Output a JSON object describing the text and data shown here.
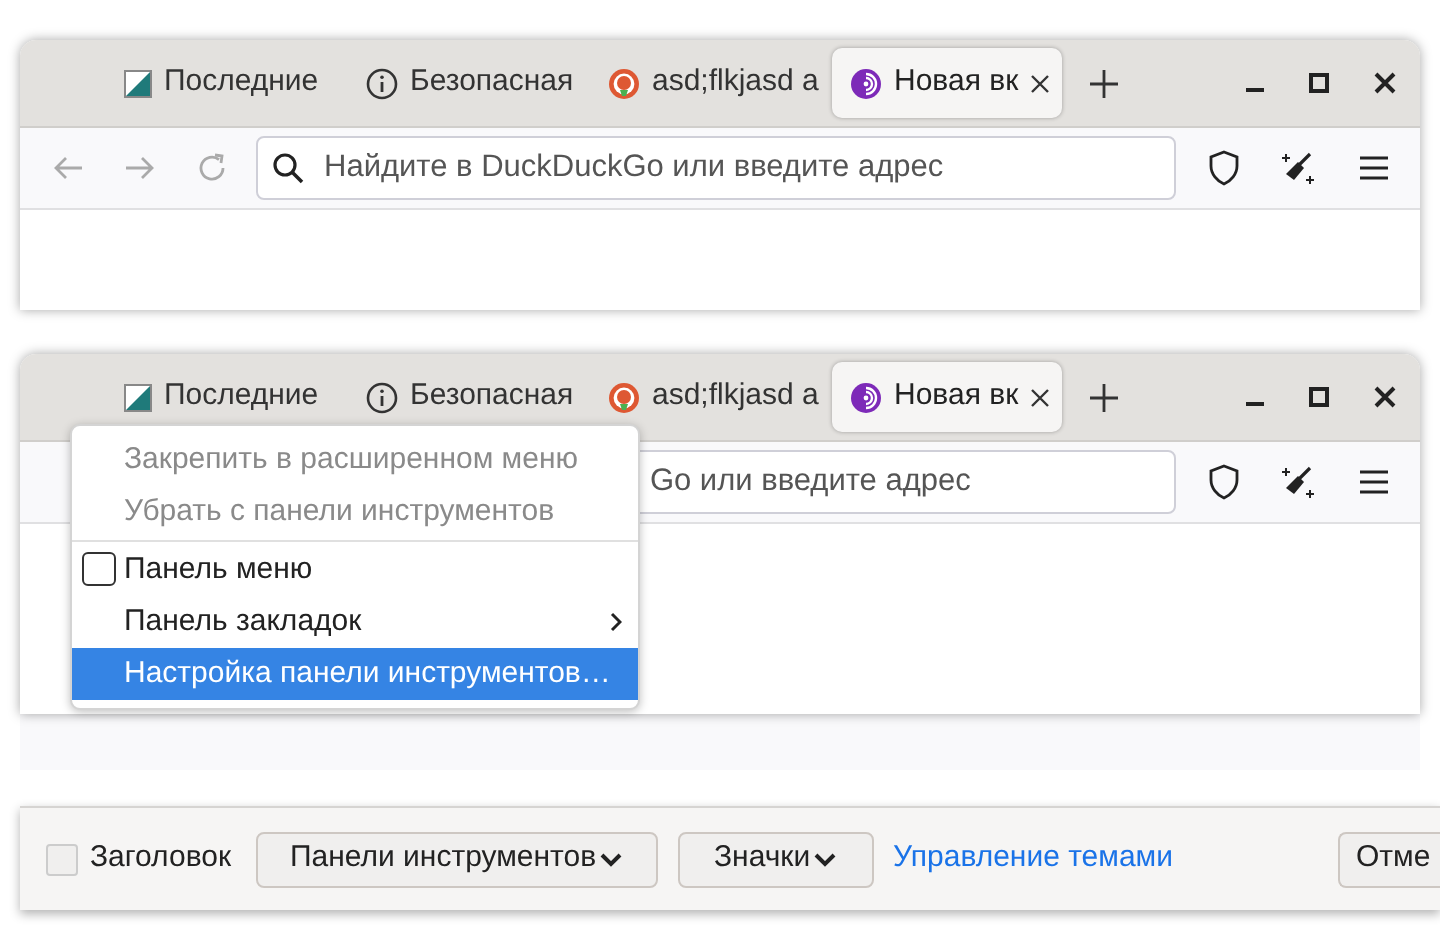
{
  "windows": [
    {
      "tabs": [
        {
          "label": "Последние",
          "selected": false
        },
        {
          "label": "Безопасная",
          "selected": false
        },
        {
          "label": "asd;flkjasd а",
          "selected": false
        },
        {
          "label": "Новая вк",
          "selected": true
        }
      ],
      "address": {
        "placeholder": "Найдите в DuckDuckGo или введите адрес"
      }
    },
    {
      "tabs": [
        {
          "label": "Последние",
          "selected": false
        },
        {
          "label": "Безопасная",
          "selected": false
        },
        {
          "label": "asd;flkjasd а",
          "selected": false
        },
        {
          "label": "Новая вк",
          "selected": true
        }
      ],
      "address": {
        "placeholder": "Go или введите адрес"
      },
      "context_menu": [
        {
          "kind": "command",
          "label": "Закрепить в расширенном меню",
          "disabled": true,
          "selected": false
        },
        {
          "kind": "command",
          "label": "Убрать с панели инструментов",
          "disabled": true,
          "selected": false
        },
        {
          "kind": "separator"
        },
        {
          "kind": "checkbox",
          "label": "Панель меню",
          "checked": false,
          "selected": false
        },
        {
          "kind": "submenu",
          "label": "Панель закладок",
          "selected": false
        },
        {
          "kind": "command",
          "label": "Настройка панели инструментов…",
          "disabled": false,
          "selected": true
        }
      ]
    }
  ],
  "footer": {
    "title_checkbox": {
      "label": "Заголовок",
      "checked": false
    },
    "buttons": [
      {
        "label": "Панели инструментов"
      },
      {
        "label": "Значки"
      }
    ],
    "link": "Управление темами",
    "cancel_button": "Отме"
  }
}
